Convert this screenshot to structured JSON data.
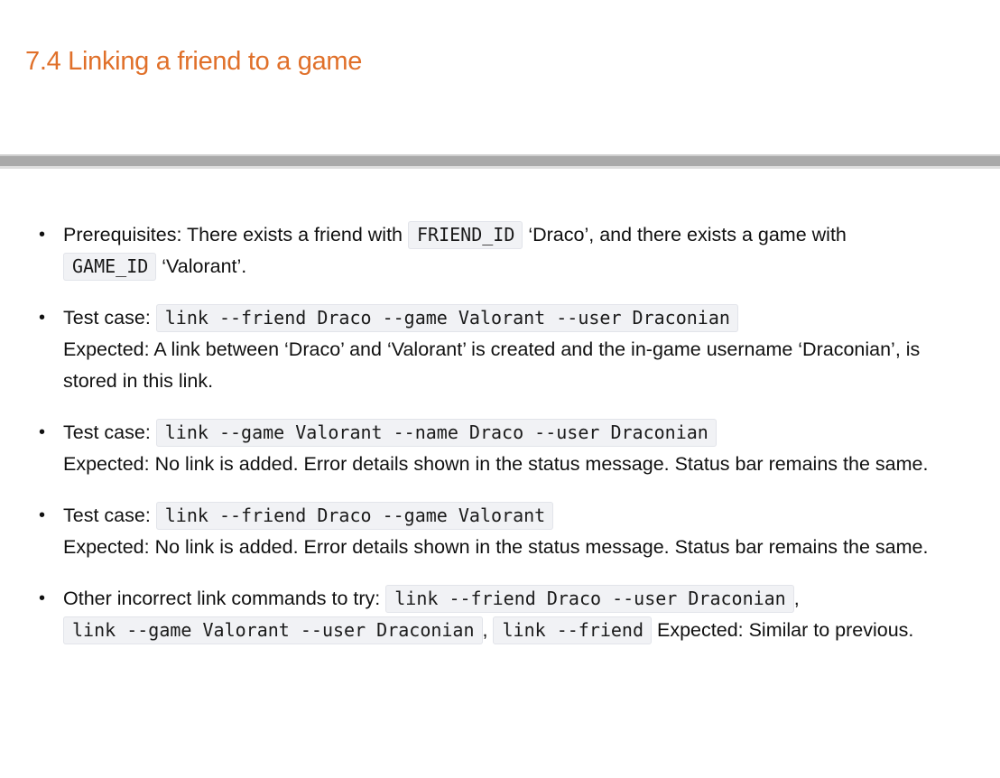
{
  "section": {
    "title": "7.4 Linking a friend to a game"
  },
  "items": [
    {
      "prereq_label": "Prerequisites: There exists a friend with ",
      "code1": "FRIEND_ID",
      "text2": " ‘Draco’, and there exists a game with ",
      "code2": "GAME_ID",
      "text3": " ‘Valorant’."
    },
    {
      "label": "Test case: ",
      "command": "link --friend Draco --game Valorant --user Draconian",
      "expected": "Expected: A link between ‘Draco’ and ‘Valorant’ is created and the in-game username ‘Draconian’, is stored in this link."
    },
    {
      "label": "Test case: ",
      "command": "link --game Valorant --name Draco --user Draconian",
      "expected": "Expected: No link is added. Error details shown in the status message. Status bar remains the same."
    },
    {
      "label": "Test case: ",
      "command": "link --friend Draco --game Valorant",
      "expected": "Expected: No link is added. Error details shown in the status message. Status bar remains the same."
    },
    {
      "label": "Other incorrect link commands to try: ",
      "command1": "link --friend Draco --user Draconian",
      "sep1": ", ",
      "command2": "link --game Valorant --user Draconian",
      "sep2": ", ",
      "command3": "link --friend",
      "expected": " Expected: Similar to previous."
    }
  ]
}
